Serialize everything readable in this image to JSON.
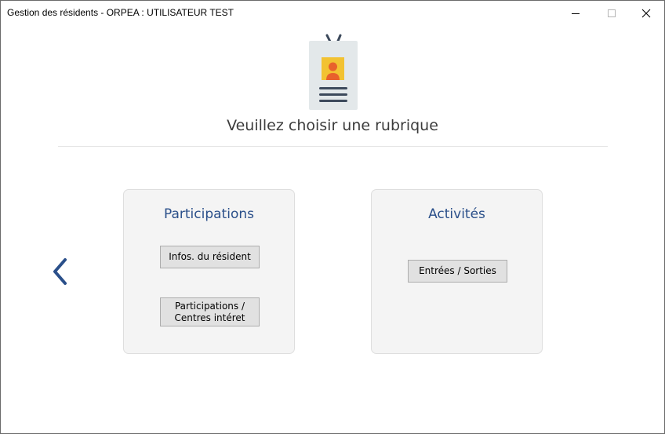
{
  "window": {
    "title": "Gestion des résidents - ORPEA : UTILISATEUR TEST",
    "controls": {
      "minimize": "minimize-icon",
      "maximize": "maximize-icon",
      "close": "close-icon"
    }
  },
  "header": {
    "icon": "id-badge-icon",
    "heading": "Veuillez choisir une rubrique"
  },
  "navigation": {
    "back_icon": "chevron-left-icon"
  },
  "cards": [
    {
      "title": "Participations",
      "buttons": [
        {
          "label_lines": [
            "Infos. du résident"
          ]
        },
        {
          "label_lines": [
            "Participations /",
            "Centres intéret"
          ]
        }
      ]
    },
    {
      "title": "Activités",
      "buttons": [
        {
          "label_lines": [
            "Entrées / Sorties"
          ]
        }
      ]
    }
  ],
  "colors": {
    "accent": "#2a4f8a",
    "card_background": "#f4f4f4",
    "button_background": "#e1e1e1",
    "badge_yellow": "#f2c232",
    "badge_orange": "#e8612c",
    "badge_body": "#e3e8ea",
    "badge_lines": "#3d4a5c"
  }
}
